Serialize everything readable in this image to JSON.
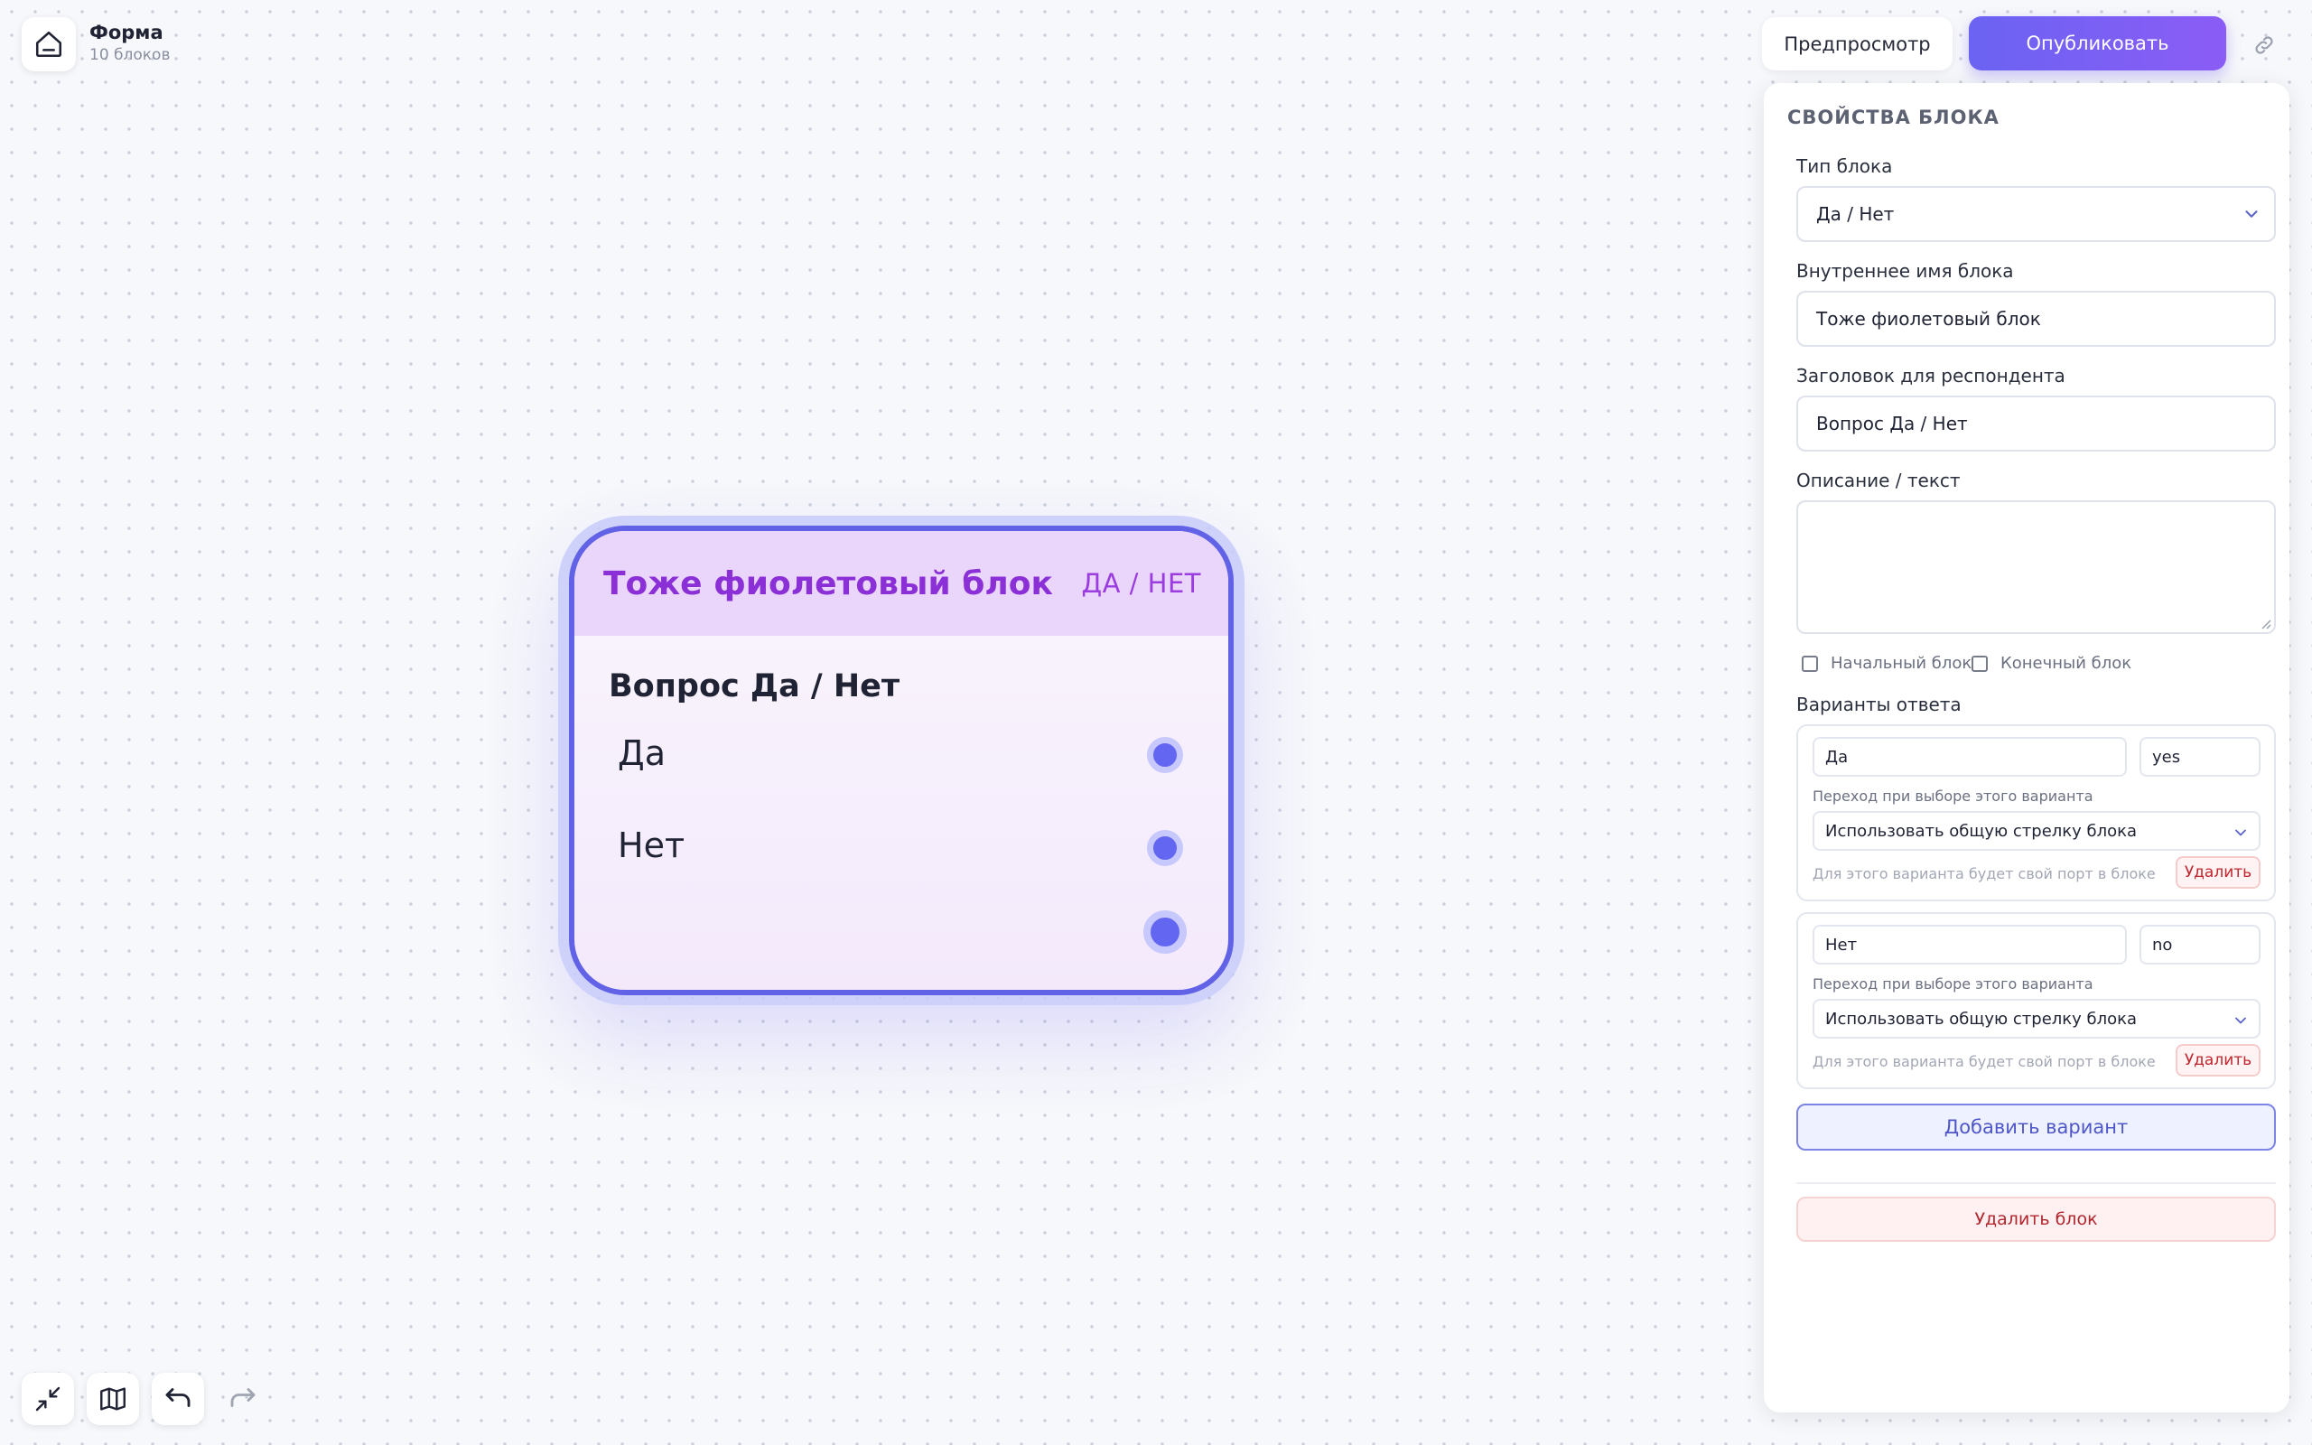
{
  "header": {
    "form_title": "Форма",
    "block_count": "10 блоков",
    "preview_label": "Предпросмотр",
    "publish_label": "Опубликовать"
  },
  "node": {
    "name": "Тоже фиолетовый блок",
    "type_label": "ДА / НЕТ",
    "question": "Вопрос Да / Нет",
    "options": [
      "Да",
      "Нет"
    ]
  },
  "panel": {
    "title": "СВОЙСТВА БЛОКА",
    "block_type_label": "Тип блока",
    "block_type_value": "Да / Нет",
    "internal_name_label": "Внутреннее имя блока",
    "internal_name_value": "Тоже фиолетовый блок",
    "respondent_title_label": "Заголовок для респондента",
    "respondent_title_value": "Вопрос Да / Нет",
    "description_label": "Описание / текст",
    "description_value": "",
    "start_block_label": "Начальный блок",
    "start_block_checked": false,
    "end_block_label": "Конечный блок",
    "end_block_checked": false,
    "answers_label": "Варианты ответа",
    "options": [
      {
        "label": "Да",
        "value": "yes",
        "transition_hint": "Переход при выборе этого варианта",
        "transition_value": "Использовать общую стрелку блока",
        "port_note": "Для этого варианта будет свой порт в блоке",
        "delete_label": "Удалить"
      },
      {
        "label": "Нет",
        "value": "no",
        "transition_hint": "Переход при выборе этого варианта",
        "transition_value": "Использовать общую стрелку блока",
        "port_note": "Для этого варианта будет свой порт в блоке",
        "delete_label": "Удалить"
      }
    ],
    "add_option_label": "Добавить вариант",
    "delete_block_label": "Удалить блок"
  },
  "icons": {
    "home": "home-icon",
    "link": "link-icon",
    "collapse": "collapse-icon",
    "map": "map-icon",
    "undo": "undo-icon",
    "redo": "redo-icon",
    "chevron": "chevron-down-icon"
  },
  "colors": {
    "accent": "#6366f1",
    "publish_gradient_start": "#6b63f2",
    "publish_gradient_end": "#8b5cf6",
    "node_title": "#8b2fd6",
    "danger": "#c0262d"
  }
}
